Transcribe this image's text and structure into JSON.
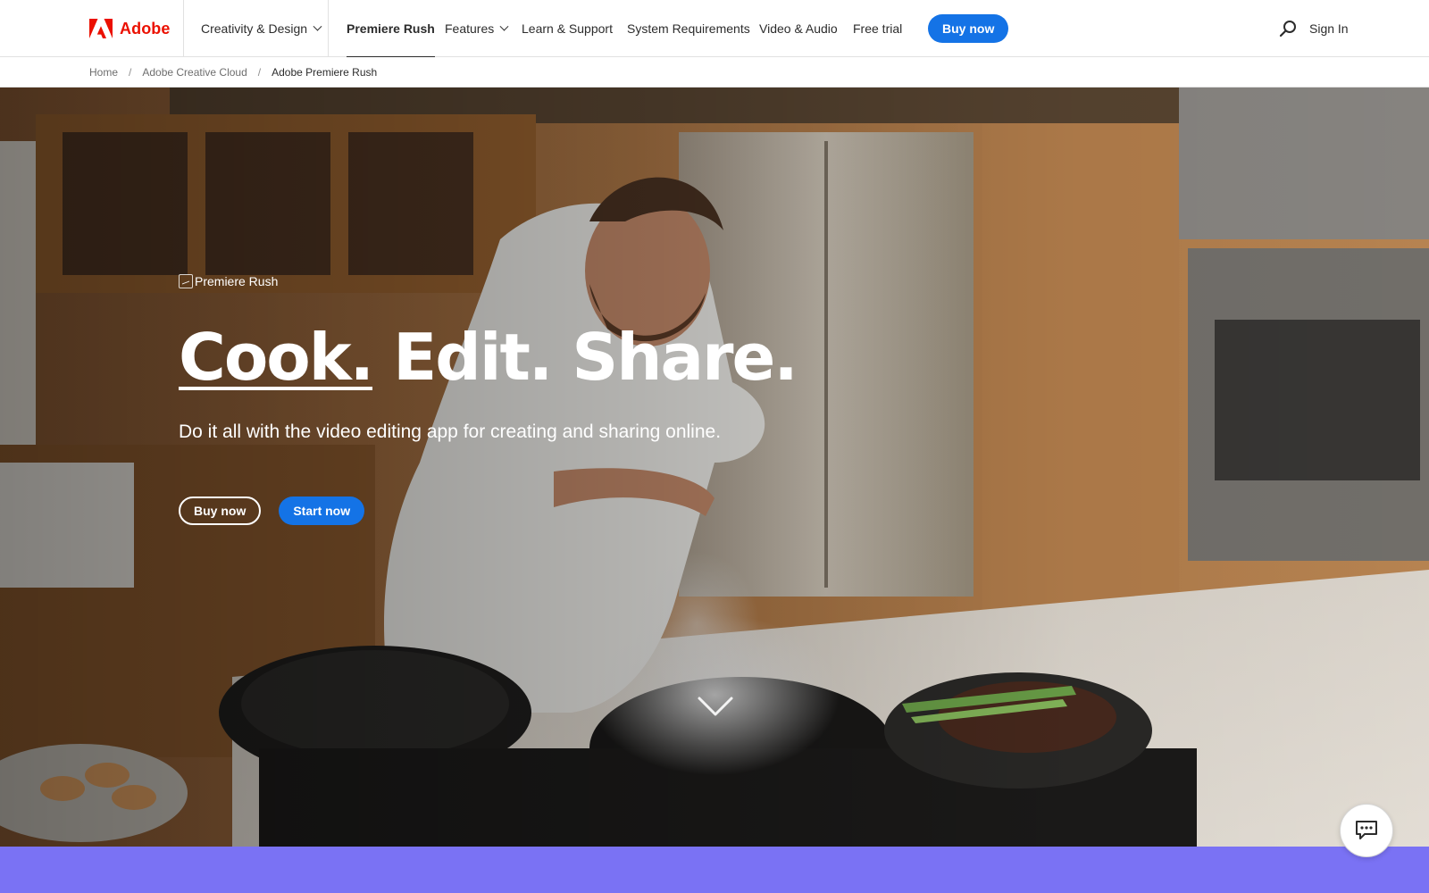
{
  "brand": {
    "name": "Adobe",
    "color": "#eb1000",
    "icon": "adobe-logo-icon"
  },
  "nav": {
    "catalog": "Creativity & Design",
    "product": "Premiere Rush",
    "items": [
      "Features",
      "Learn & Support",
      "System Requirements",
      "Video & Audio",
      "Free trial"
    ],
    "buy_label": "Buy now",
    "search_icon": "search-icon",
    "signin_label": "Sign In",
    "accent": "#1473e6"
  },
  "breadcrumb": [
    "Home",
    "Adobe Creative Cloud",
    "Adobe Premiere Rush"
  ],
  "hero": {
    "product_logo_alt": "Premiere Rush",
    "headline_underlined": "Cook.",
    "headline_rest": "Edit. Share.",
    "subhead": "Do it all with the video editing app for creating and sharing online.",
    "cta_primary": "Buy now",
    "cta_secondary": "Start now",
    "scroll_icon": "chevron-down-icon"
  },
  "footer_band": {
    "color": "#7a72f4"
  },
  "chat": {
    "icon": "chat-bubble-icon"
  }
}
